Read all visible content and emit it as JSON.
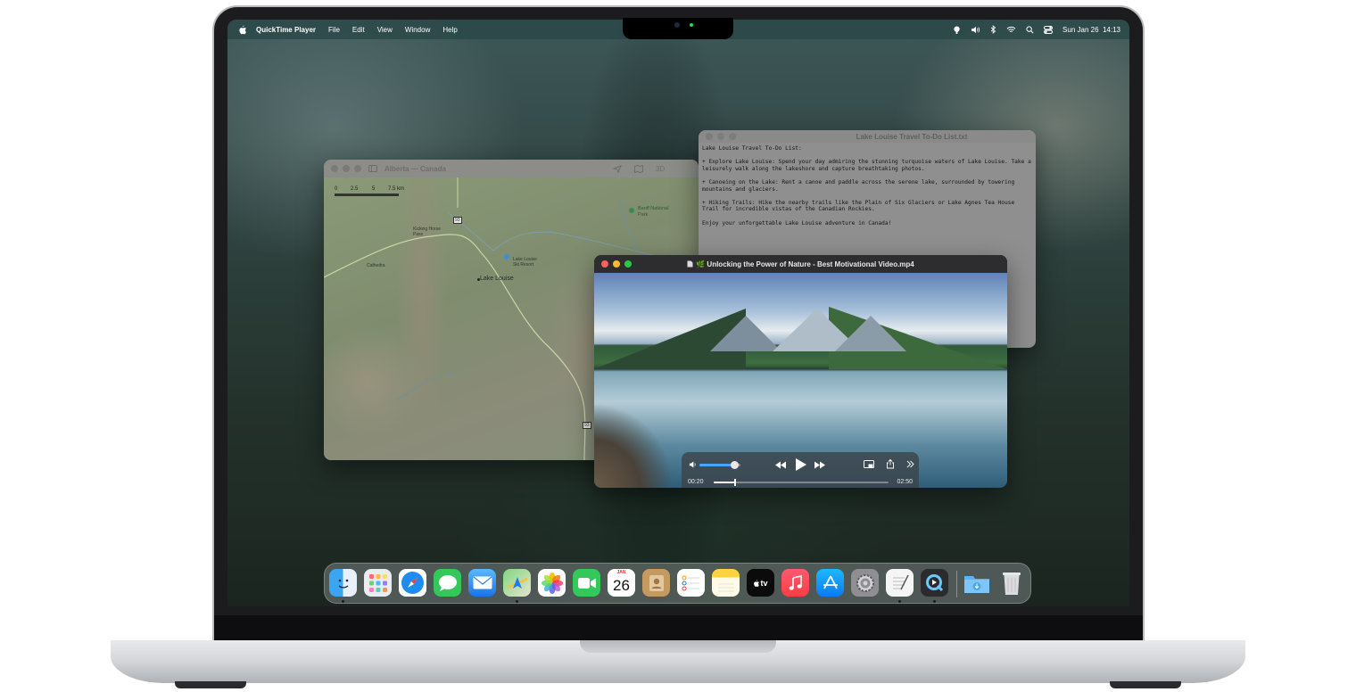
{
  "menubar": {
    "app_name": "QuickTime Player",
    "menus": [
      "File",
      "Edit",
      "View",
      "Window",
      "Help"
    ],
    "date_time": "Sun Jan 26  14:13",
    "status_icons": [
      "airplay-icon",
      "volume-icon",
      "bluetooth-icon",
      "wifi-icon",
      "search-icon",
      "control-center-icon"
    ]
  },
  "maps_window": {
    "title": "Alberta — Canada",
    "toolbar_value": "3D",
    "scale_labels": [
      "0",
      "2.5",
      "5",
      "7.5 km"
    ],
    "places": {
      "lake_louise": "Lake Louise",
      "kicking_horse": "Kicking Horse Pass",
      "lake_louise_ski": "Lake Louise Ski Resort",
      "banff": "Banff National Park",
      "cathedra": "Cathedra",
      "hwy_93": "93",
      "hwy_93_south": "93"
    }
  },
  "notes_window": {
    "title": "Lake Louise Travel To-Do List.txt",
    "text": "Lake Louise Travel To-Do List:\n\n+ Explore Lake Louise: Spend your day admiring the stunning turquoise waters of Lake Louise. Take a leisurely walk along the lakeshore and capture breathtaking photos.\n\n+ Canoeing on the Lake: Rent a canoe and paddle across the serene lake, surrounded by towering mountains and glaciers.\n\n+ Hiking Trails: Hike the nearby trails like the Plain of Six Glaciers or Lake Agnes Tea House Trail for incredible vistas of the Canadian Rockies.\n\nEnjoy your unforgettable Lake Louise adventure in Canada!"
  },
  "player_window": {
    "title": "🌿 Unlocking the Power of Nature - Best Motivational Video.mp4",
    "current_time": "00:20",
    "duration": "02:50",
    "progress": 0.12,
    "volume": 0.85
  },
  "dock": {
    "apps": [
      {
        "name": "Finder",
        "icon": "finder-icon",
        "running": true
      },
      {
        "name": "Launchpad",
        "icon": "launchpad-icon",
        "running": false
      },
      {
        "name": "Safari",
        "icon": "safari-icon",
        "running": false
      },
      {
        "name": "Messages",
        "icon": "messages-icon",
        "running": false
      },
      {
        "name": "Mail",
        "icon": "mail-icon",
        "running": false
      },
      {
        "name": "Maps",
        "icon": "maps-icon",
        "running": true
      },
      {
        "name": "Photos",
        "icon": "photos-icon",
        "running": false
      },
      {
        "name": "FaceTime",
        "icon": "facetime-icon",
        "running": false
      },
      {
        "name": "Calendar",
        "icon": "calendar-icon",
        "running": false
      },
      {
        "name": "Contacts",
        "icon": "contacts-icon",
        "running": false
      },
      {
        "name": "Reminders",
        "icon": "reminders-icon",
        "running": false
      },
      {
        "name": "Notes",
        "icon": "notes-icon",
        "running": false
      },
      {
        "name": "TV",
        "icon": "tv-icon",
        "running": false
      },
      {
        "name": "Music",
        "icon": "music-icon",
        "running": false
      },
      {
        "name": "App Store",
        "icon": "app-store-icon",
        "running": false
      },
      {
        "name": "System Settings",
        "icon": "settings-icon",
        "running": false
      },
      {
        "name": "TextEdit",
        "icon": "textedit-icon",
        "running": true
      },
      {
        "name": "QuickTime Player",
        "icon": "quicktime-icon",
        "running": true
      }
    ],
    "calendar": {
      "month": "JAN",
      "day": "26"
    },
    "tv_label": "tv"
  },
  "colors": {
    "close": "#ff5f57",
    "minimize": "#febc2e",
    "zoom": "#28c840",
    "volume_fill": "#4aa3ff"
  }
}
